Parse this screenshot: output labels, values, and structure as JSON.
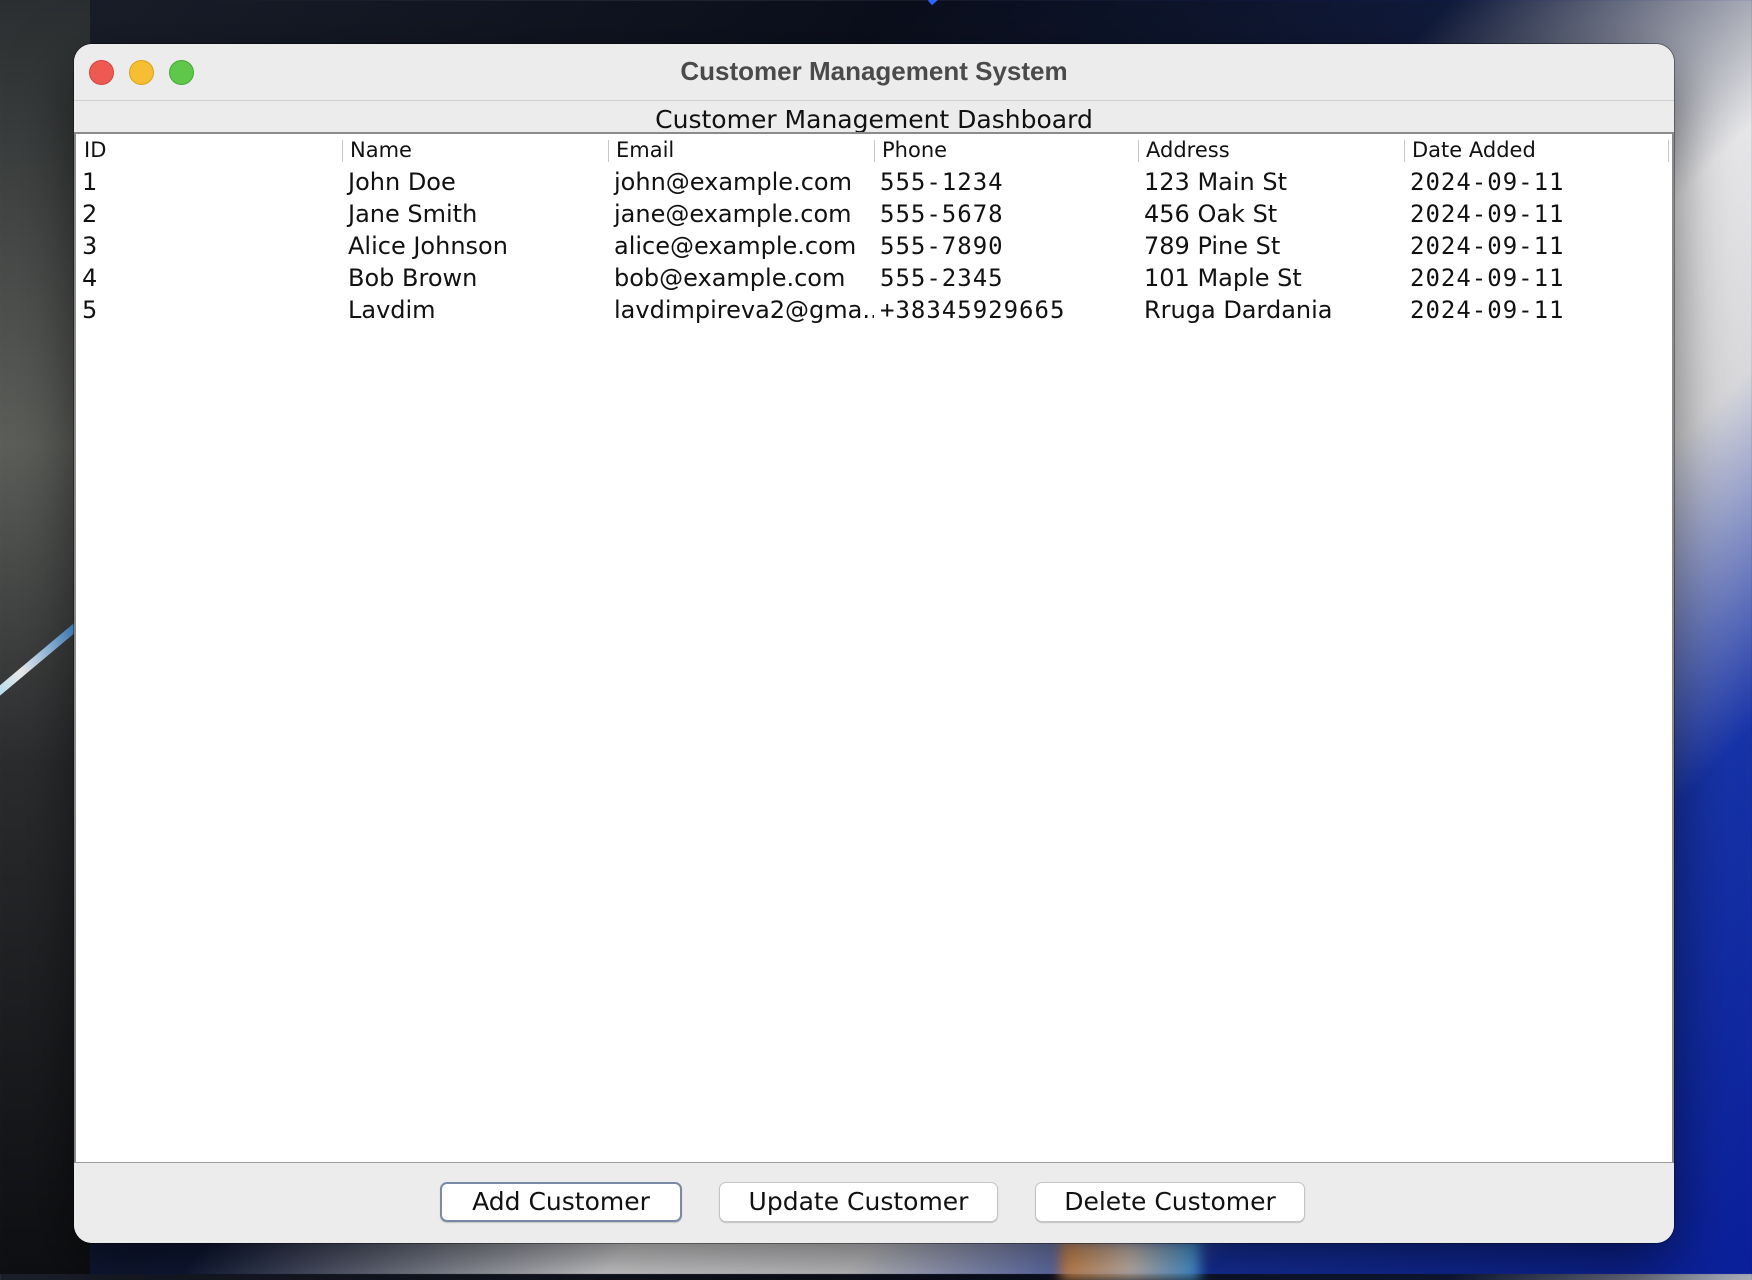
{
  "window": {
    "title": "Customer Management System"
  },
  "dashboard": {
    "heading": "Customer Management Dashboard"
  },
  "table": {
    "columns": [
      "ID",
      "Name",
      "Email",
      "Phone",
      "Address",
      "Date Added"
    ],
    "rows": [
      [
        "1",
        "John Doe",
        "john@example.com",
        "555-1234",
        "123 Main St",
        "2024-09-11"
      ],
      [
        "2",
        "Jane Smith",
        "jane@example.com",
        "555-5678",
        "456 Oak St",
        "2024-09-11"
      ],
      [
        "3",
        "Alice Johnson",
        "alice@example.com",
        "555-7890",
        "789 Pine St",
        "2024-09-11"
      ],
      [
        "4",
        "Bob Brown",
        "bob@example.com",
        "555-2345",
        "101 Maple St",
        "2024-09-11"
      ],
      [
        "5",
        "Lavdim",
        "lavdimpireva2@gma...",
        "+38345929665",
        "Rruga Dardania",
        "2024-09-11"
      ]
    ]
  },
  "buttons": {
    "add": "Add Customer",
    "update": "Update Customer",
    "delete": "Delete Customer"
  },
  "colors": {
    "close": "#ee5a52",
    "minimize": "#f5be33",
    "zoom": "#5fc84a",
    "window_bg": "#ececec",
    "table_bg": "#ffffff"
  }
}
